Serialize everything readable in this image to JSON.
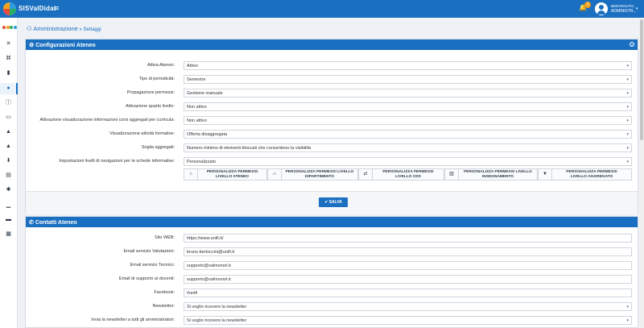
{
  "app": {
    "title": "SISValDidat"
  },
  "topbar": {
    "notification_count": "2",
    "welcome": "BENVENUTO,",
    "user": "ADMINISTR..."
  },
  "breadcrumb": {
    "section": "Amministrazione",
    "current": "Settaggi"
  },
  "config_panel": {
    "title": "Configurazioni Ateneo",
    "rows": [
      {
        "label": "Attiva Ateneo:",
        "value": "Attivo"
      },
      {
        "label": "Tipo di periodicità:",
        "value": "Semestre"
      },
      {
        "label": "Propagazione permessi:",
        "value": "Gestione manuale"
      },
      {
        "label": "Attivazione quarto livello:",
        "value": "Non attivo"
      },
      {
        "label": "Attivazione visualizzazione informazioni corsi aggregati per curricula:",
        "value": "Non attivo"
      },
      {
        "label": "Visualizzazione attività formative:",
        "value": "Offerta disaggregata"
      },
      {
        "label": "Soglia aggregati:",
        "value": "Numero minimo di elementi bloccati che consentono la visibilità"
      },
      {
        "label": "Impostazioni livelli di navigazioni per le schede informative:",
        "value": "Personalizzato"
      }
    ],
    "customize_buttons": [
      {
        "line1": "PERSONALIZZA PERMESSI",
        "line2": "LIVELLO ATENEO",
        "icon": "home-icon"
      },
      {
        "line1": "PERSONALIZZA PERMESSI LIVELLO",
        "line2": "DIPARTIMENTO",
        "icon": "institution-icon"
      },
      {
        "line1": "PERSONALIZZA PERMESSI",
        "line2": "LIVELLO CDS",
        "icon": "swap-icon"
      },
      {
        "line1": "PERSONALIZZA PERMESSI LIVELLO",
        "line2": "INSEGNAMENTO",
        "icon": "book-icon"
      },
      {
        "line1": "PERSONALIZZA PERMESSI",
        "line2": "LIVELLO AGGREGATO",
        "icon": "filter-icon"
      }
    ],
    "save_label": "SALVA"
  },
  "contacts_panel": {
    "title": "Contatti Ateneo",
    "rows": [
      {
        "label": "Sito WEB:",
        "value": "https://www.unifi.it/"
      },
      {
        "label": "Email servizio Valutazioni:",
        "value": "bruno.bertoccini@unifi.it"
      },
      {
        "label": "Email servizio Tecnico:",
        "value": "supporto@valmonsrl.it"
      },
      {
        "label": "Email di supporto ai docenti:",
        "value": "supporto@valmonsrl.it"
      },
      {
        "label": "Facebook:",
        "value": "#unifi"
      },
      {
        "label": "Newsletter:",
        "value": "Si voglio ricevere la newsletter"
      },
      {
        "label": "Invia la newsletter a tutti gli amministratori:",
        "value": "Si voglio ricevere la newsletter"
      }
    ]
  },
  "colors": {
    "primary": "#1a6fc0",
    "badge": "#f39c12"
  }
}
